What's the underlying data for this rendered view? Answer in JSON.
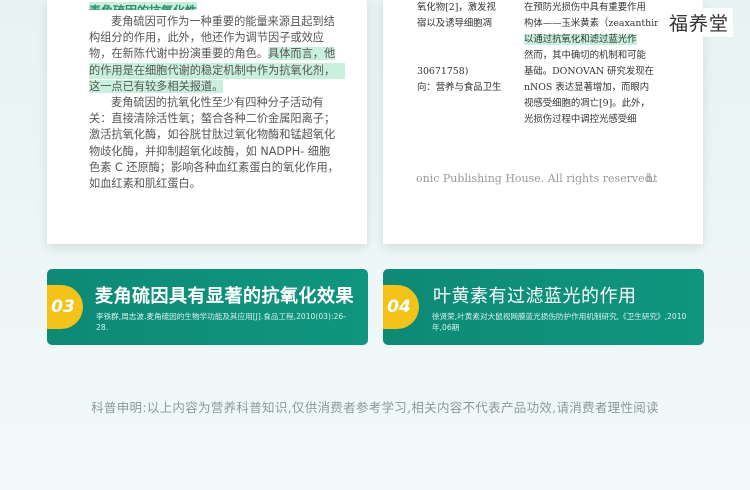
{
  "brand": "福养堂",
  "left_doc": {
    "heading_fragment": "麦角硫因的抗氧化性",
    "lines": [
      "麦角硫因可作为一种重要的能量来源且起到结",
      "构组分的作用，此外，他还作为调节因子或效应",
      "物，在新陈代谢中扮演重要的角色。具体而言，他",
      "的作用是在细胞代谢的稳定机制中作为抗氧化剂，",
      "这一点已有较多相关报道。",
      "麦角硫因的抗氧化性至少有四种分子活动有",
      "关：直接清除活性氧；螯合各种二价金属阳离子；",
      "激活抗氧化酶，如谷胱甘肽过氧化物酶和锰超氧化",
      "物歧化酶，并抑制超氧化歧酶，如 NADPH- 细胞",
      "色素 C 还原酶；影响各种血红素蛋白的氧化作用，",
      "如血红素和肌红蛋白。"
    ]
  },
  "right_doc": {
    "col1": [
      "氧化物[2]，激发视",
      "宿以及诱导细胞凋",
      "",
      "",
      "30671758)",
      "向：营养与食品卫生"
    ],
    "col2": [
      "在预防光损伤中具有重要作用",
      "构体——玉米黄素（zeaxanthin",
      "以通过抗氧化和滤过蓝光作",
      "然而，其中确切的机制和可能",
      "基础。DONOVAN 研究发现在",
      "nNOS 表达显著增加，而眼内",
      "视感受细胞的凋亡[9]。此外，",
      "光损伤过程中调控光感受细"
    ],
    "footer": "onic Publishing House. All rights reserved.",
    "footer_tail": "ht"
  },
  "cards": [
    {
      "number": "03",
      "title": "麦角硫因具有显著的抗氧化效果",
      "ref": "李铁群,周志波.麦角硫因的生物学功能及其应用[J].食品工程,2010(03):26-28."
    },
    {
      "number": "04",
      "title": "叶黄素有过滤蓝光的作用",
      "ref": "徐贤荣,叶黄素对大鼠视网膜蓝光损伤防护作用机制研究,《卫生研究》,2010年,06期"
    }
  ],
  "disclaimer": "科普申明:以上内容为营养科普知识,仅供消费者参考学习,相关内容不代表产品功效,请消费者理性阅读",
  "colors": {
    "card_green": "#0e8a76",
    "badge_yellow": "#f3c31a",
    "highlight": "#c9f0dc",
    "background": "#e6f3f1"
  }
}
